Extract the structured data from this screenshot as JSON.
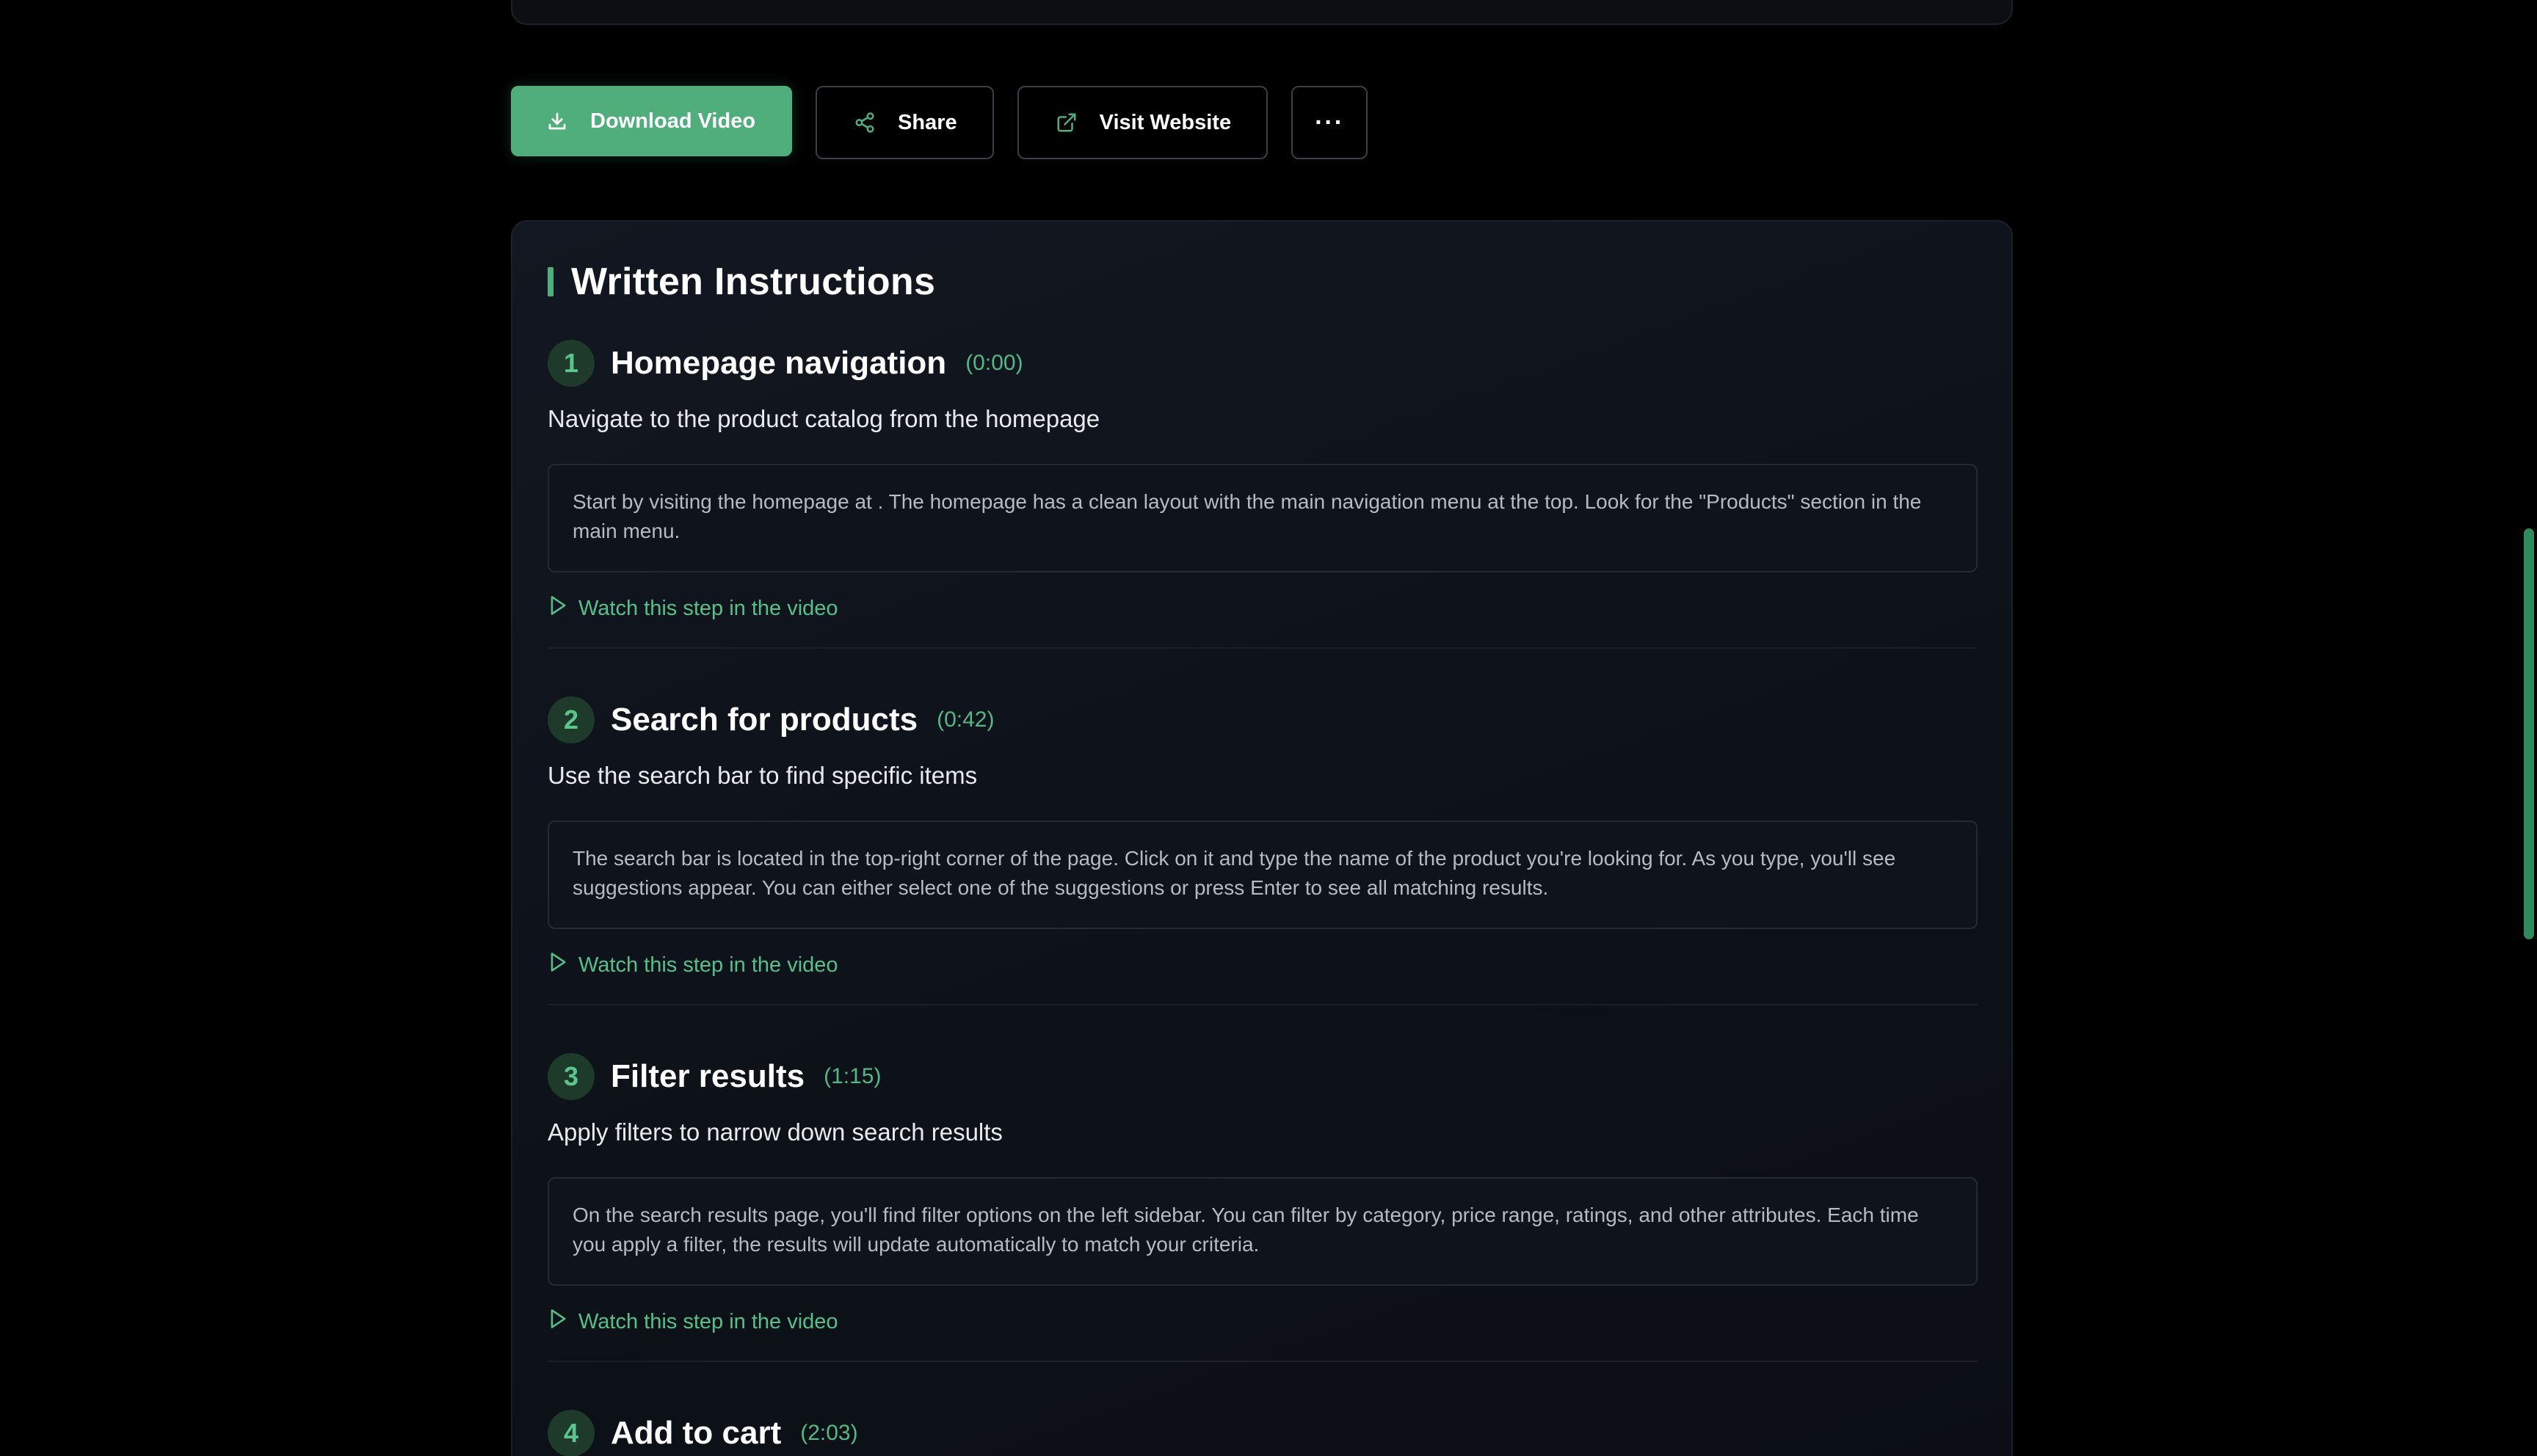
{
  "actions": {
    "download_label": "Download Video",
    "share_label": "Share",
    "visit_label": "Visit Website",
    "more_label": "···"
  },
  "instructions": {
    "title": "Written Instructions",
    "watch_label": "Watch this step in the video",
    "steps": [
      {
        "number": "1",
        "title": "Homepage navigation",
        "time": "(0:00)",
        "subtitle": "Navigate to the product catalog from the homepage",
        "detail": "Start by visiting the homepage at . The homepage has a clean layout with the main navigation menu at the top. Look for the \"Products\" section in the main menu."
      },
      {
        "number": "2",
        "title": "Search for products",
        "time": "(0:42)",
        "subtitle": "Use the search bar to find specific items",
        "detail": "The search bar is located in the top-right corner of the page. Click on it and type the name of the product you're looking for. As you type, you'll see suggestions appear. You can either select one of the suggestions or press Enter to see all matching results."
      },
      {
        "number": "3",
        "title": "Filter results",
        "time": "(1:15)",
        "subtitle": "Apply filters to narrow down search results",
        "detail": "On the search results page, you'll find filter options on the left sidebar. You can filter by category, price range, ratings, and other attributes. Each time you apply a filter, the results will update automatically to match your criteria."
      },
      {
        "number": "4",
        "title": "Add to cart",
        "time": "(2:03)"
      }
    ]
  },
  "colors": {
    "accent": "#4fae7c",
    "accent_text": "#55c08a",
    "background": "#000000",
    "card": "#0d1118"
  },
  "icons": {
    "download": "download-icon",
    "share": "share-icon",
    "visit": "external-link-icon",
    "play": "play-icon"
  }
}
